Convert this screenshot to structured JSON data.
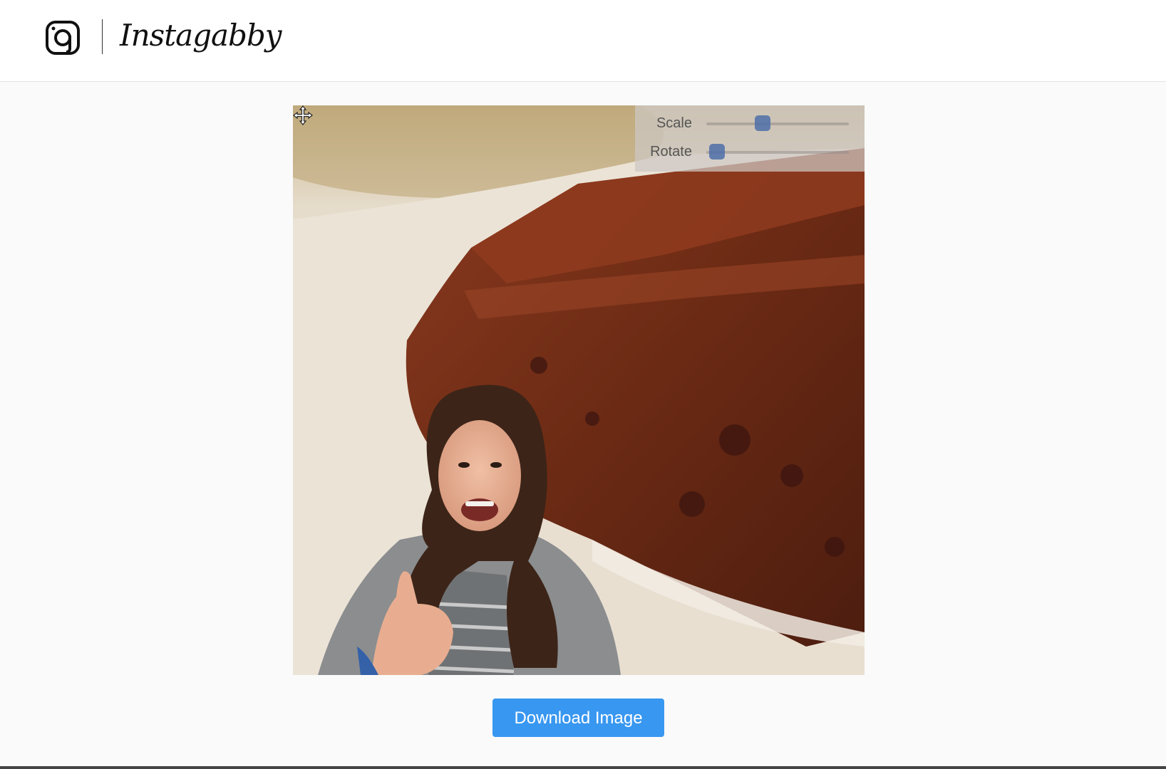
{
  "app": {
    "brand": "Instagabby",
    "logo_icon": "instagram-camera-icon"
  },
  "editor": {
    "controls": {
      "scale_label": "Scale",
      "scale_level": 0.38,
      "rotate_label": "Rotate",
      "rotate_level": 0.02
    },
    "cursor_icon": "move-cursor-icon"
  },
  "actions": {
    "download_label": "Download Image"
  },
  "colors": {
    "accent": "#3897f0",
    "slider_thumb": "#4e6fa8"
  }
}
